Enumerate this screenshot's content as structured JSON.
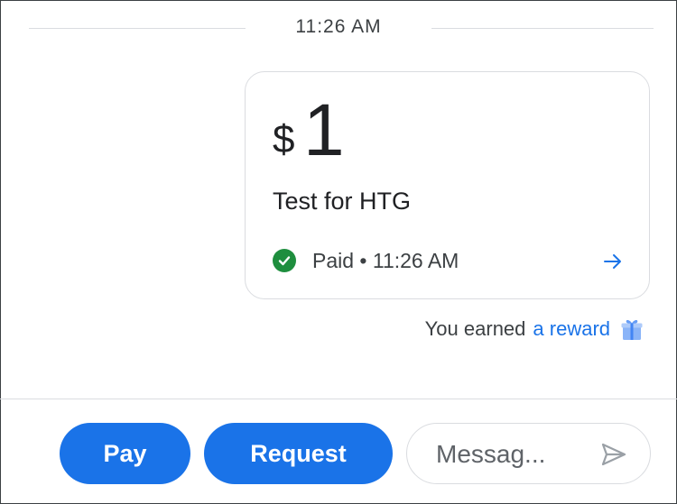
{
  "timestamp": "11:26 AM",
  "payment": {
    "currency": "$",
    "amount": "1",
    "note": "Test for HTG",
    "status": "Paid • 11:26 AM"
  },
  "reward": {
    "prefix": "You earned",
    "link": "a reward"
  },
  "actions": {
    "pay_label": "Pay",
    "request_label": "Request"
  },
  "message": {
    "placeholder": "Messag..."
  },
  "icons": {
    "status": "check-circle-icon",
    "details": "arrow-right-icon",
    "reward": "gift-icon",
    "send": "send-icon"
  },
  "colors": {
    "accent": "#1a73e8",
    "success": "#1e8e3e"
  }
}
